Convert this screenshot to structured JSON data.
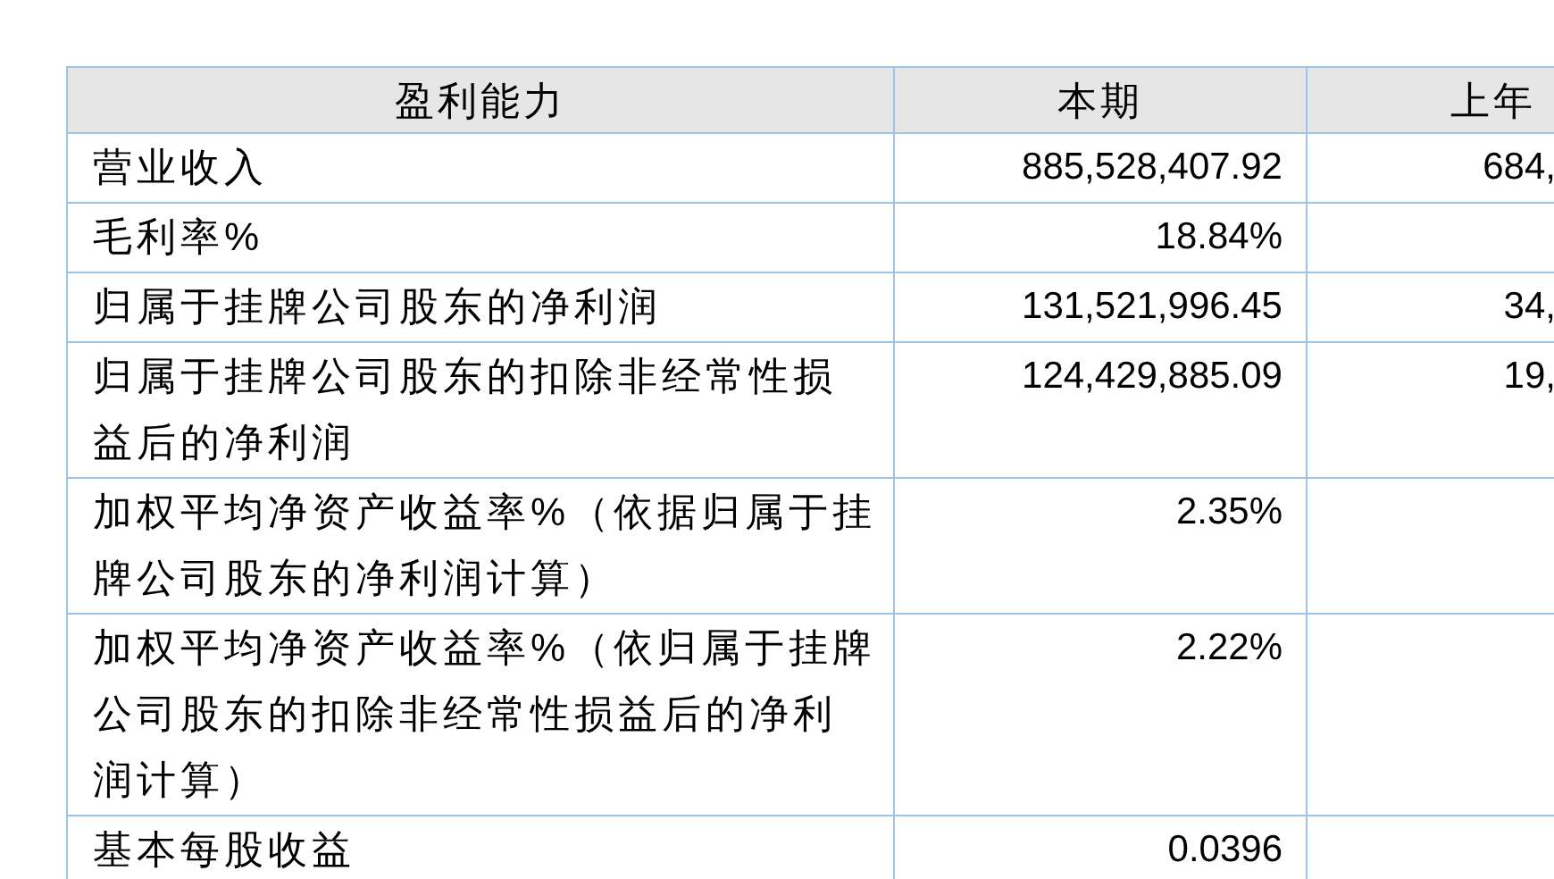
{
  "table": {
    "columns": [
      "盈利能力",
      "本期",
      "上年"
    ],
    "rows": [
      [
        "营业收入",
        "885,528,407.92",
        "684,"
      ],
      [
        "毛利率%",
        "18.84%",
        ""
      ],
      [
        "归属于挂牌公司股东的净利润",
        "131,521,996.45",
        "34,"
      ],
      [
        "归属于挂牌公司股东的扣除非经常性损益后的净利润",
        "124,429,885.09",
        "19,"
      ],
      [
        "加权平均净资产收益率%（依据归属于挂牌公司股东的净利润计算）",
        "2.35%",
        ""
      ],
      [
        "加权平均净资产收益率%（依归属于挂牌公司股东的扣除非经常性损益后的净利润计算）",
        "2.22%",
        ""
      ],
      [
        "基本每股收益",
        "0.0396",
        ""
      ]
    ]
  }
}
